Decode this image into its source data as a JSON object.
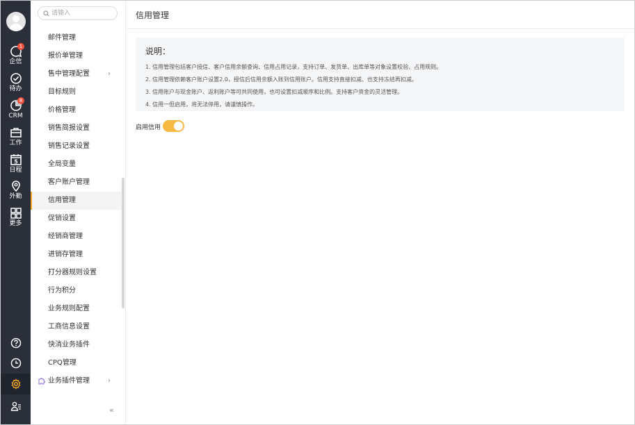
{
  "rail": {
    "items": [
      {
        "label": "企信",
        "icon": "chat-bubble-icon",
        "badge": "1"
      },
      {
        "label": "待办",
        "icon": "check-circle-icon"
      },
      {
        "label": "CRM",
        "icon": "pie-chart-icon",
        "badge": "8"
      },
      {
        "label": "工作",
        "icon": "briefcase-icon"
      },
      {
        "label": "日程",
        "icon": "calendar-icon",
        "day": "5"
      },
      {
        "label": "外勤",
        "icon": "location-pin-icon"
      },
      {
        "label": "更多",
        "icon": "grid-icon"
      }
    ],
    "bottom": [
      "help-icon",
      "clock-icon",
      "settings-gear-icon",
      "user-list-icon"
    ],
    "accent": "#f5a623"
  },
  "menu": {
    "search_placeholder": "请输入",
    "items": [
      {
        "label": "邮件管理"
      },
      {
        "label": "报价单管理"
      },
      {
        "label": "售中管理配置",
        "chevron": "›"
      },
      {
        "label": "目标规则"
      },
      {
        "label": "价格管理"
      },
      {
        "label": "销售简报设置"
      },
      {
        "label": "销售记录设置"
      },
      {
        "label": "全局变量"
      },
      {
        "label": "客户账户管理"
      },
      {
        "label": "信用管理",
        "active": true
      },
      {
        "label": "促销设置"
      },
      {
        "label": "经销商管理"
      },
      {
        "label": "进销存管理"
      },
      {
        "label": "打分器规则设置"
      },
      {
        "label": "行为积分"
      },
      {
        "label": "业务规则配置"
      },
      {
        "label": "工商信息设置"
      },
      {
        "label": "快消业务插件"
      },
      {
        "label": "CPQ管理"
      },
      {
        "label": "业务插件管理",
        "chevron": "›",
        "icon": "puzzle-icon"
      }
    ],
    "collapse_label": "«"
  },
  "content": {
    "title": "信用管理",
    "notice": {
      "title": "说明：",
      "lines": [
        "1. 信用管理包括客户授信、客户信用余额查询、信用占用记录，支持订单、发货单、出库单等对象设置校验、占用规则。",
        "2. 信用管理依赖客户账户设置2.0，授信后信用余额入账到信用账户。信用支持直接扣减、也支持冻结再扣减。",
        "3. 信用账户与现金账户、返利账户等可共同使用，也可设置扣减顺序和比例。支持客户资金的灵活管理。",
        "4. 信用一但启用，将无法停用，请谨慎操作。"
      ]
    },
    "toggle": {
      "label": "启用信用",
      "on": true,
      "color": "#f5b944"
    }
  }
}
